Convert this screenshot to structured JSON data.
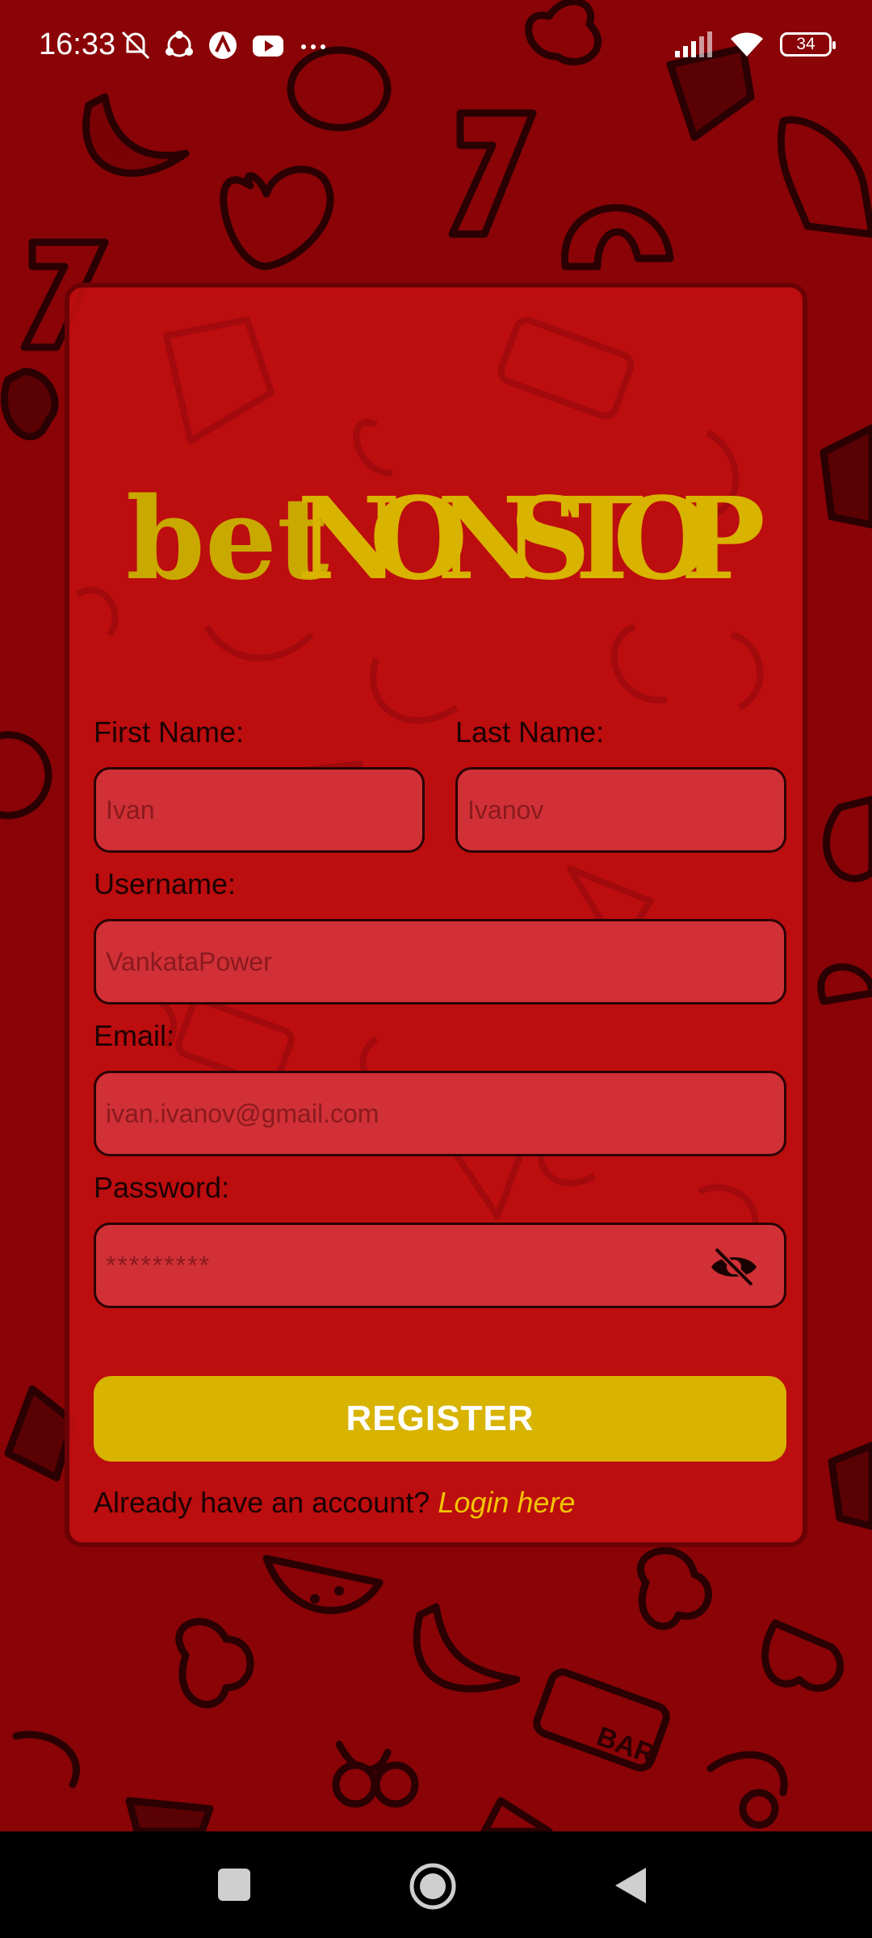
{
  "status_bar": {
    "time": "16:33",
    "battery": "34",
    "left_icons": [
      "muted-vibrate-icon",
      "network-share-icon",
      "app-a-icon",
      "youtube-icon",
      "more-dots-icon"
    ],
    "right_icons": [
      "signal-icon",
      "wifi-icon",
      "battery-icon"
    ]
  },
  "brand": {
    "name": "betNONSTOP",
    "prefix": "bet",
    "suffix": "NONSTOP",
    "color": "#d8b300"
  },
  "form": {
    "first_name_label": "First Name:",
    "first_name_placeholder": "Ivan",
    "last_name_label": "Last Name:",
    "last_name_placeholder": "Ivanov",
    "username_label": "Username:",
    "username_placeholder": "VankataPower",
    "email_label": "Email:",
    "email_placeholder": "ivan.ivanov@gmail.com",
    "password_label": "Password:",
    "password_placeholder": "*********",
    "register_label": "REGISTER",
    "login_prompt": "Already have an account?",
    "login_link": "Login here"
  },
  "colors": {
    "background": "#8a0306",
    "card": "#c00e10",
    "input": "#d03036",
    "accent": "#d8b300",
    "link": "#f2c400"
  },
  "nav_bar": {
    "icons": [
      "recents-square-icon",
      "home-circle-icon",
      "back-triangle-icon"
    ]
  }
}
